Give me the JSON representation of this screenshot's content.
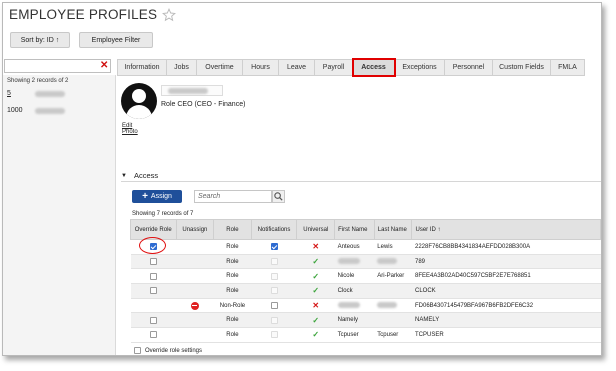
{
  "header": {
    "title": "EMPLOYEE PROFILES"
  },
  "toolbar": {
    "sort_label": "Sort by: ID ↑",
    "filter_label": "Employee Filter"
  },
  "left_list": {
    "showing": "Showing 2 records of 2",
    "items": [
      {
        "id": "5"
      },
      {
        "id": "1000"
      }
    ]
  },
  "tabs": [
    "Information",
    "Jobs",
    "Overtime",
    "Hours",
    "Leave",
    "Payroll",
    "Access",
    "Exceptions",
    "Personnel",
    "Custom Fields",
    "FMLA"
  ],
  "active_tab": "Access",
  "profile": {
    "role_label": "Role",
    "role_value": "CEO (CEO - Finance)",
    "edit_photo": "Edit Photo"
  },
  "access": {
    "section_title": "Access",
    "assign_label": "Assign",
    "search_placeholder": "Search",
    "showing": "Showing 7 records of 7",
    "columns": [
      "Override Role",
      "Unassign",
      "Role",
      "Notifications",
      "Universal",
      "First Name",
      "Last Name",
      "User ID ↑"
    ],
    "rows": [
      {
        "override": "checked",
        "unassign": "",
        "role": "Role",
        "notifications": "checked",
        "universal": "x",
        "first": "Anteous",
        "last": "Lewis",
        "userid": "2228F76CB8BB4341834AEFDD028B300A"
      },
      {
        "override": "empty",
        "unassign": "",
        "role": "Role",
        "notifications": "faint",
        "universal": "check",
        "first": "",
        "last": "",
        "userid": "789"
      },
      {
        "override": "empty",
        "unassign": "",
        "role": "Role",
        "notifications": "faint",
        "universal": "check",
        "first": "Nicole",
        "last": "Ari-Parker",
        "userid": "8FEE4A3B02AD40C597C5BF2E7E768851"
      },
      {
        "override": "empty",
        "unassign": "",
        "role": "Role",
        "notifications": "faint",
        "universal": "check",
        "first": "Clock",
        "last": "",
        "userid": "CLOCK"
      },
      {
        "override": "",
        "unassign": "no-entry",
        "role": "Non-Role",
        "notifications": "empty",
        "universal": "x",
        "first": "",
        "last": "",
        "userid": "FD06B4307145479BFA967B6FB2DFE6C32"
      },
      {
        "override": "empty",
        "unassign": "",
        "role": "Role",
        "notifications": "faint",
        "universal": "check",
        "first": "Namely",
        "last": "",
        "userid": "NAMELY"
      },
      {
        "override": "empty",
        "unassign": "",
        "role": "Role",
        "notifications": "faint",
        "universal": "check",
        "first": "Tcpuser",
        "last": "Tcpuser",
        "userid": "TCPUSER"
      }
    ],
    "override_settings_label": "Override role settings"
  },
  "colors": {
    "accent_blue": "#1f4f9a",
    "highlight_red": "#e00000",
    "check_green": "#39a339",
    "x_red": "#d41414"
  }
}
